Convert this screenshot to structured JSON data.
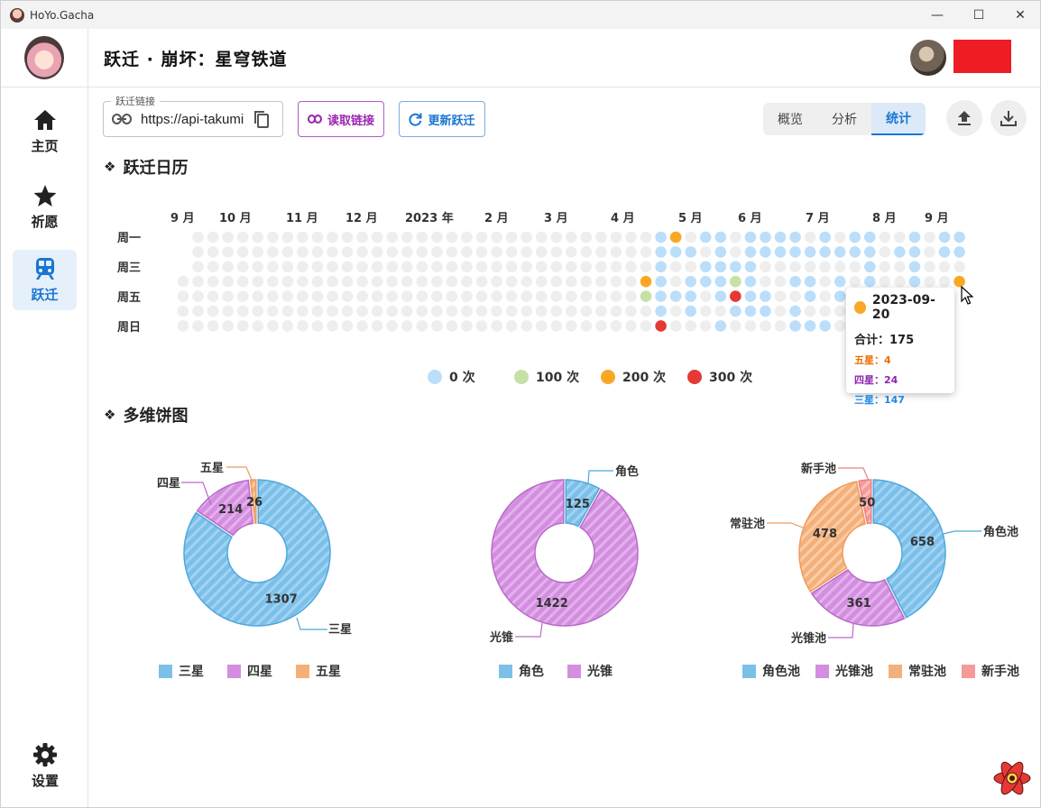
{
  "window": {
    "title": "HoYo.Gacha",
    "minimize_glyph": "—",
    "maximize_glyph": "☐",
    "close_glyph": "✕"
  },
  "sidebar": {
    "items": [
      {
        "label": "主页",
        "icon": "home-icon"
      },
      {
        "label": "祈愿",
        "icon": "star-icon"
      },
      {
        "label": "跃迁",
        "icon": "train-icon",
        "active": true
      }
    ],
    "settings_label": "设置"
  },
  "header": {
    "title": "跃迁 · 崩坏：星穹铁道"
  },
  "toolbar": {
    "url_legend": "跃迁链接",
    "url_value": "https://api-takumi",
    "read_link_label": "读取链接",
    "update_label": "更新跃迁",
    "tabs": [
      "概览",
      "分析",
      "统计"
    ],
    "active_tab": "统计"
  },
  "sections": {
    "calendar_title": "跃迁日历",
    "pies_title": "多维饼图"
  },
  "calendar": {
    "months": [
      "9 月",
      "10 月",
      "11 月",
      "12 月",
      "2023 年",
      "2 月",
      "3 月",
      "4 月",
      "5 月",
      "6 月",
      "7 月",
      "8 月",
      "9 月"
    ],
    "days": [
      "周一",
      "周三",
      "周五",
      "周日"
    ],
    "legend": [
      "0 次",
      "100 次",
      "200 次",
      "300 次"
    ],
    "colors": {
      "none": "#eeeeee",
      "low": "#bbdefb",
      "c100": "#c5e1a5",
      "c200": "#f9a825",
      "c300": "#e53935"
    },
    "tooltip": {
      "date": "2023-09-20",
      "total": "合计：175",
      "five": "五星：4",
      "four": "四星：24",
      "three": "三星：147",
      "five_color": "#ef6c00",
      "four_color": "#8e24aa",
      "three_color": "#1e88e5"
    }
  },
  "chart_data": [
    {
      "type": "pie",
      "categories": [
        "三星",
        "四星",
        "五星"
      ],
      "values": [
        1307,
        214,
        26
      ],
      "colors": [
        "#7cc0ea",
        "#d48ee0",
        "#f5b07a"
      ]
    },
    {
      "type": "pie",
      "categories": [
        "角色",
        "光锥"
      ],
      "values": [
        125,
        1422
      ],
      "colors": [
        "#7cc0ea",
        "#d48ee0"
      ]
    },
    {
      "type": "pie",
      "categories": [
        "角色池",
        "光锥池",
        "常驻池",
        "新手池"
      ],
      "values": [
        658,
        361,
        478,
        50
      ],
      "colors": [
        "#7cc0ea",
        "#d48ee0",
        "#f5b07a",
        "#f59a9a"
      ]
    }
  ]
}
